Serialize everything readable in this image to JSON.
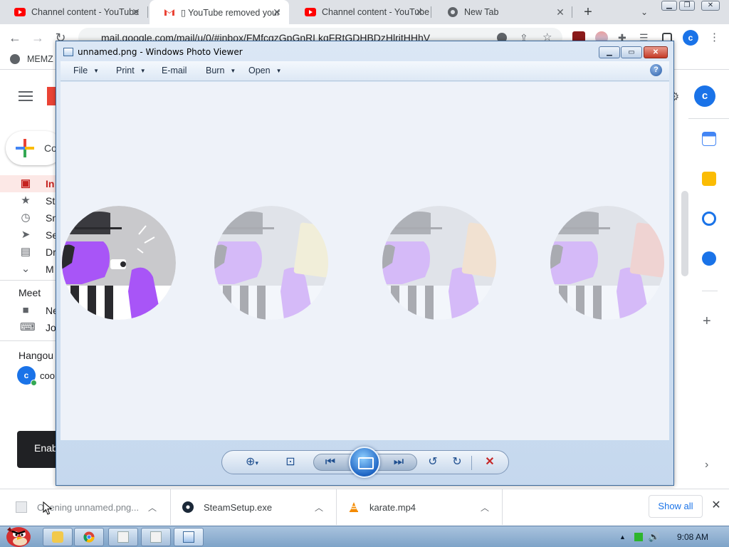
{
  "browser": {
    "tabs": [
      {
        "title": "Channel content - YouTube",
        "icon": "youtube-icon",
        "active": false
      },
      {
        "title": "▯ YouTube removed your",
        "icon": "gmail-icon",
        "active": true
      },
      {
        "title": "Channel content - YouTube",
        "icon": "youtube-icon",
        "active": false
      },
      {
        "title": "New Tab",
        "icon": "chrome-icon",
        "active": false
      }
    ],
    "url": "mail.google.com/mail/u/0/#inbox/FMfcgzGpGnRLkqFRtGDHBDzHlritHHhV",
    "bookmark": "MEMZ",
    "profile_initial": "c"
  },
  "gmail": {
    "compose_label": "Co",
    "nav": [
      {
        "label": "In",
        "icon": "inbox-icon"
      },
      {
        "label": "St",
        "icon": "star-icon"
      },
      {
        "label": "Sn",
        "icon": "clock-icon"
      },
      {
        "label": "Se",
        "icon": "send-icon"
      },
      {
        "label": "Dr",
        "icon": "draft-icon"
      },
      {
        "label": "M",
        "icon": "chevron-down-icon"
      }
    ],
    "meet_heading": "Meet",
    "meet_items": [
      {
        "label": "Ne",
        "icon": "video-icon"
      },
      {
        "label": "Jo",
        "icon": "keyboard-icon"
      }
    ],
    "hangouts_heading": "Hangou",
    "hangouts_user": "coo",
    "hangouts_initial": "c",
    "snackbar_text": "Enab",
    "profile_initial": "c"
  },
  "photo_viewer": {
    "title": "unnamed.png - Windows Photo Viewer",
    "menus": [
      {
        "label": "File",
        "has_caret": true
      },
      {
        "label": "Print",
        "has_caret": true
      },
      {
        "label": "E-mail",
        "has_caret": false
      },
      {
        "label": "Burn",
        "has_caret": true
      },
      {
        "label": "Open",
        "has_caret": true
      }
    ],
    "help_label": "?",
    "frames": [
      {
        "card_color": "none",
        "opacity": 1.0
      },
      {
        "card_color": "#f7e9a0",
        "opacity": 0.35
      },
      {
        "card_color": "#f7c48a",
        "opacity": 0.35
      },
      {
        "card_color": "#f29a8c",
        "opacity": 0.35
      }
    ],
    "controls": [
      "zoom-icon",
      "fit-to-window-icon",
      "previous-icon",
      "slideshow-icon",
      "next-icon",
      "rotate-counterclockwise-icon",
      "rotate-clockwise-icon",
      "delete-icon"
    ]
  },
  "downloads": {
    "items": [
      {
        "label": "Opening unnamed.png...",
        "icon": "image-file-icon"
      },
      {
        "label": "SteamSetup.exe",
        "icon": "steam-icon"
      },
      {
        "label": "karate.mp4",
        "icon": "vlc-icon"
      }
    ],
    "show_all": "Show all"
  },
  "taskbar": {
    "clock": "9:08 AM"
  },
  "colors": {
    "gmail_red": "#c5221f",
    "accent_blue": "#1a73e8",
    "wpv_frame": "#c5d8ee",
    "figure_purple": "#a855f7"
  }
}
